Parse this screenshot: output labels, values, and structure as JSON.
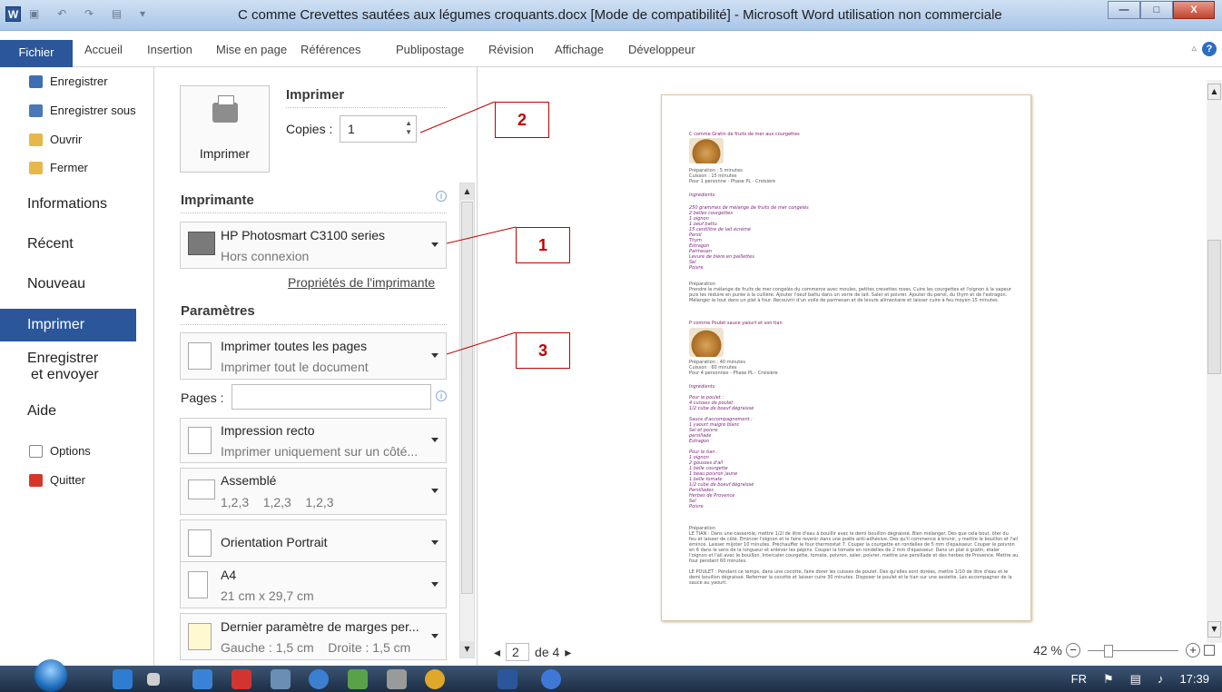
{
  "window": {
    "title": "C comme Crevettes sautées aux légumes croquants.docx [Mode de compatibilité]  -  Microsoft Word utilisation non commerciale",
    "app_icon": "W",
    "minimize_label": "—",
    "maximize_label": "□",
    "close_label": "X"
  },
  "ribbon": {
    "tabs": [
      "Fichier",
      "Accueil",
      "Insertion",
      "Mise en page",
      "Références",
      "Publipostage",
      "Révision",
      "Affichage",
      "Développeur"
    ],
    "help_label": "?"
  },
  "backstage": {
    "small_items": [
      "Enregistrer",
      "Enregistrer sous",
      "Ouvrir",
      "Fermer"
    ],
    "big_items": [
      "Informations",
      "Récent",
      "Nouveau"
    ],
    "selected": "Imprimer",
    "send_line1": "Enregistrer",
    "send_line2": "et envoyer",
    "help": "Aide",
    "bottom_items": [
      "Options",
      "Quitter"
    ]
  },
  "print": {
    "button_label": "Imprimer",
    "heading": "Imprimer",
    "copies_label": "Copies :",
    "copies_value": "1",
    "printer_heading": "Imprimante",
    "printer_name": "HP Photosmart C3100 series",
    "printer_status": "Hors connexion",
    "printer_properties": "Propriétés de l'imprimante",
    "settings_heading": "Paramètres",
    "pages_label": "Pages :",
    "settings": [
      {
        "line1": "Imprimer toutes les pages",
        "line2": "Imprimer tout le document"
      },
      {
        "line1": "Impression recto",
        "line2": "Imprimer uniquement sur un côté..."
      },
      {
        "line1": "Assemblé",
        "line2": "1,2,3    1,2,3    1,2,3"
      },
      {
        "line1": "Orientation Portrait",
        "line2": ""
      },
      {
        "line1": "A4",
        "line2": "21 cm x 29,7 cm"
      },
      {
        "line1": "Dernier paramètre de marges per...",
        "line2": "Gauche : 1,5 cm    Droite : 1,5 cm"
      }
    ]
  },
  "preview": {
    "page_current": "2",
    "page_total": "de 4",
    "zoom": "42 %",
    "recipe1_title": "C comme Gratin de fruits de mer aux courgettes",
    "recipe1_meta": "Préparation : 5 minutes\nCuisson : 15 minutes\nPour 1 personne - Phase PL - Croisière",
    "recipe1_ing_title": "Ingrédients",
    "recipe1_ingredients": "250 grammes de mélange de fruits de mer congelés\n2 belles courgettes\n1 oignon\n1 oeuf battu\n15 centilitre de lait écrémé\nPersil\nThym\nEstragon\nParmesan\nLevure de bière en paillettes\nSel\nPoivre",
    "recipe1_prep": "Préparation\nPrendre le mélange de fruits de mer congelés du commerce avec moules, petites crevettes roses. Cuire les courgettes et l'oignon à la vapeur\npuis les réduire en purée à la cuillère. Ajouter l'oeuf battu dans un verre de lait. Saler et poivrer. Ajouter du persil, du thym et de l'estragon.\nMélanger le tout dans un plat à four. Recouvrir d'un voile de parmesan et de levure alimentaire et laisser cuire à feu moyen 15 minutes.",
    "recipe2_title": "P comme Poulet sauce yaourt et son tian",
    "recipe2_meta": "Préparation : 40 minutes\nCuisson : 60 minutes\nPour 4 personnes - Phase PL - Croisière",
    "recipe2_ing_title": "Ingrédients",
    "recipe2_ingredients": "Pour le poulet :\n4 cuisses de poulet\n1/2 cube de boeuf dégraissé\n\nSauce d'accompagnement :\n1 yaourt maigre blanc\nSel et poivre\npersillade\nEstragon\n\nPour le tian :\n1 oignon\n2 gousses d'ail\n1 belle courgette\n1 beau poivron jaune\n1 belle tomate\n1/2 cube de boeuf dégraissé\nPersillades\nHerbes de Provence\nSel\nPoivre",
    "recipe2_prep": "Préparation\nLE TIAN : Dans une casserole, mettre 1/2l de litre d'eau à bouillir avec le demi bouillon dégraissé. Bien mélanger. Dès que cela bout, ôter du\nfeu et laisser de côté. Emincer l'oignon et le faire revenir dans une poêle anti-adhésive. Dès qu'il commence à brunir, y mettre le bouillon et l'ail\némincé. Laisser mijoter 10 minutes. Préchauffer le four thermostat 7. Couper la courgette en rondelles de 5 mm d'épaisseur. Couper le poivron\nen 6 dans le sens de la longueur et enlever les pépins. Couper la tomate en rondelles de 2 mm d'épaisseur. Dans un plat à gratin, étaler\nl'oignon et l'ail avec le bouillon. Intercaler courgette, tomate, poivron, saler, poivrer, mettre une persillade et des herbes de Provence. Mettre au\nfour pendant 60 minutes.",
    "recipe2_prep2": "LE POULET : Pendant ce temps, dans une cocotte, faire dorer les cuisses de poulet. Dès qu'elles sont dorées, mettre 1/10 de litre d'eau et le\ndemi bouillon dégraissé. Refermer la cocotte et laisser cuire 30 minutes. Disposer le poulet et le tian sur une assiette. Les accompagner de la\nsauce au yaourt."
  },
  "callouts": [
    "1",
    "2",
    "3"
  ],
  "taskbar": {
    "lang": "FR",
    "time": "17:39"
  },
  "colors": {
    "accent": "#2b579a",
    "callout": "#c00000",
    "recipe_title": "#8b1a6e"
  }
}
